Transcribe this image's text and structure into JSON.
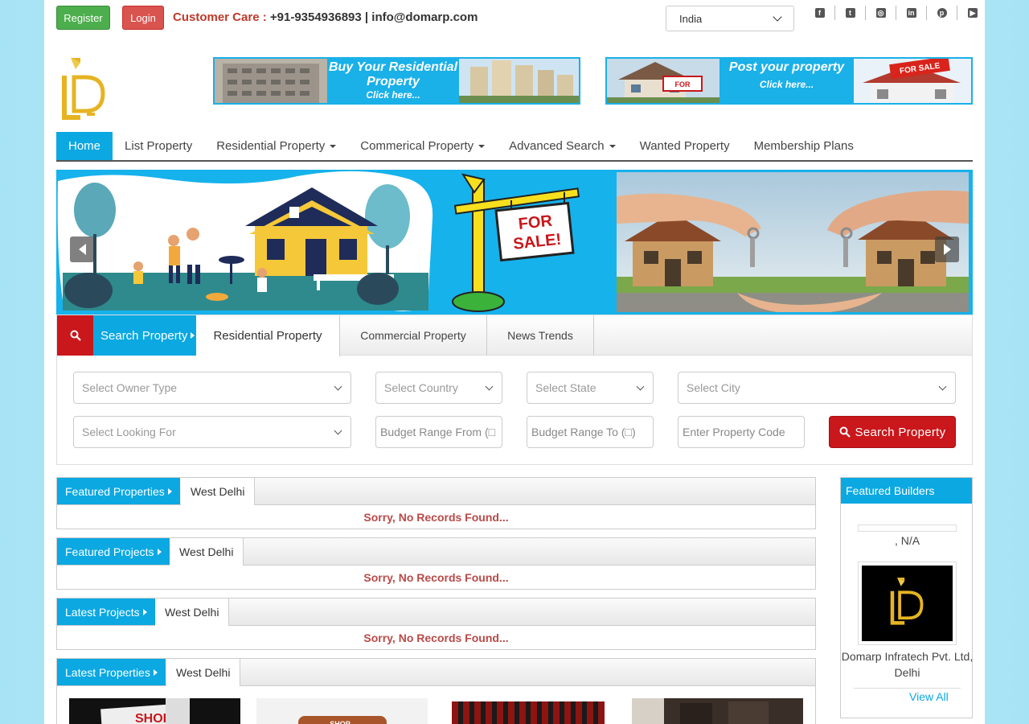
{
  "topbar": {
    "register_label": "Register",
    "login_label": "Login",
    "care_label": "Customer Care :",
    "care_phone": "+91-9354936893",
    "care_sep": "|",
    "care_email": "info@domarp.com",
    "country_selected": "India",
    "social": [
      "facebook-icon",
      "twitter-icon",
      "instagram-icon",
      "linkedin-icon",
      "pinterest-icon",
      "youtube-icon"
    ]
  },
  "banners": {
    "buy": {
      "line1": "Buy Your Residential",
      "line2": "Property",
      "line3": "Click here..."
    },
    "post": {
      "line1": "Post your property",
      "line2": "Click here..."
    }
  },
  "nav": {
    "items": [
      {
        "label": "Home",
        "active": true
      },
      {
        "label": "List Property"
      },
      {
        "label": "Residential Property",
        "dropdown": true
      },
      {
        "label": "Commerical Property",
        "dropdown": true
      },
      {
        "label": "Advanced Search",
        "dropdown": true
      },
      {
        "label": "Wanted Property"
      },
      {
        "label": "Membership Plans"
      }
    ]
  },
  "slider": {
    "sign_line1": "FOR",
    "sign_line2": "SALE!"
  },
  "search": {
    "panel_label": "Search Property",
    "tabs": [
      "Residential Property",
      "Commercial Property",
      "News Trends"
    ],
    "owner_type": "Select Owner Type",
    "country": "Select Country",
    "state": "Select State",
    "city": "Select City",
    "looking_for": "Select Looking For",
    "budget_from": "Budget Range From (□",
    "budget_to": "Budget Range To (□)",
    "property_code": "Enter Property Code",
    "button": "Search Property"
  },
  "sections": [
    {
      "title": "Featured Properties",
      "location": "West Delhi",
      "empty": "Sorry, No Records Found..."
    },
    {
      "title": "Featured Projects",
      "location": "West Delhi",
      "empty": "Sorry, No Records Found..."
    },
    {
      "title": "Latest Projects",
      "location": "West Delhi",
      "empty": "Sorry, No Records Found..."
    },
    {
      "title": "Latest Properties",
      "location": "West Delhi"
    }
  ],
  "sidebar": {
    "title": "Featured Builders",
    "builder1_location": ", N/A",
    "builder2_name": "Domarp Infratech Pvt. Ltd, Delhi",
    "view_all": "View All"
  },
  "colors": {
    "brand_blue": "#0ba8e2",
    "brand_red": "#c9171b",
    "register_green": "#4cae4c",
    "empty_text": "#b94a48",
    "logo_gold": "#e6b422"
  }
}
